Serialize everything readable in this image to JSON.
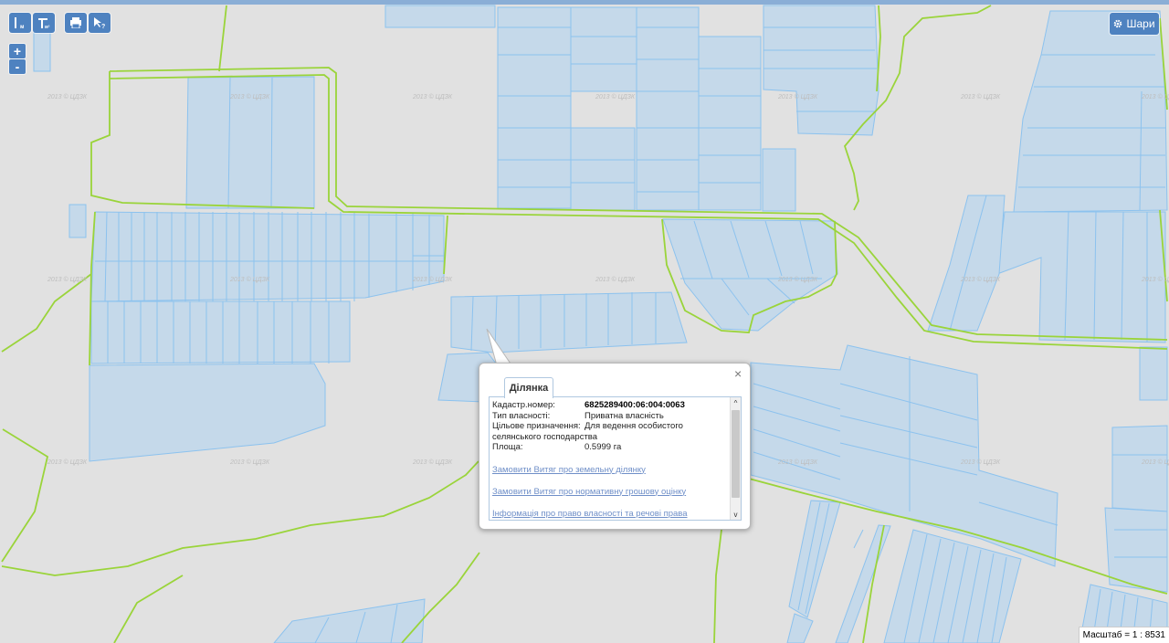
{
  "toolbar": {
    "measure_length_icon": "ruler-length-icon",
    "measure_area_icon": "ruler-area-icon",
    "print_icon": "printer-icon",
    "identify_icon": "cursor-help-icon"
  },
  "zoom": {
    "plus": "+",
    "minus": "-"
  },
  "layers_button": {
    "icon": "gear-icon",
    "label": "Шари"
  },
  "watermark": "2013 © ЦДЗК",
  "popup": {
    "tab": "Ділянка",
    "fields": [
      {
        "label": "Кадастр.номер:",
        "value": "6825289400:06:004:0063",
        "bold": true
      },
      {
        "label": "Тип власності:",
        "value": "Приватна власність"
      },
      {
        "label": "Цільове призначення:",
        "value": "Для ведення особистого"
      },
      {
        "label": "Площа:",
        "value": "0.5999 га"
      }
    ],
    "purpose_continuation": "селянського господарства",
    "links": [
      "Замовити Витяг про земельну ділянку",
      "Замовити Витяг про нормативну грошову оцінку",
      "Інформація про право власності та речові права"
    ],
    "scroll_up": "^",
    "scroll_down": "v",
    "close": "×"
  },
  "scale": "Масштаб = 1 : 8531",
  "colors": {
    "background": "#e1e1e1",
    "parcel_fill": "#c5d9ea",
    "parcel_stroke": "#8cc2ee",
    "boundary": "#9ad43a",
    "button": "#4e82c0",
    "link": "#6f8fc8"
  }
}
